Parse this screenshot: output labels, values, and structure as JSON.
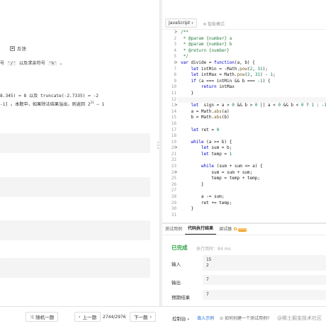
{
  "left": {
    "meta": {
      "flag_label": "反馈"
    },
    "desc_line1": {
      "a": "号 ",
      "code1": "'/'",
      "b": " 以及求余符号 ",
      "code2": "'%'",
      "c": " 。"
    },
    "desc_line2": {
      "a": "8.345) = 8 以及 truncate(-2.7335) = -2"
    },
    "desc_line3": {
      "a": "-1] 。本题中，如果除法结果溢出，则返回 2",
      "sup": "31",
      "b": " − 1"
    }
  },
  "editor": {
    "language": "JavaScript",
    "smart_mode": "智能模式",
    "line_numbers": [
      "1",
      "2",
      "3",
      "4",
      "5",
      "6",
      "7",
      "8",
      "9",
      "10",
      "11",
      "12",
      "13",
      "14",
      "15",
      "16",
      "17",
      "18",
      "19",
      "20",
      "21",
      "22",
      "23",
      "24",
      "25",
      "26",
      "27",
      "28",
      "29",
      "30",
      "31"
    ]
  },
  "console": {
    "tabs": [
      "测试用例",
      "代码执行结果",
      "调试器"
    ],
    "debugger_badge": "Beta",
    "status": "已完成",
    "runtime": "执行用时：84 ms",
    "input_label": "输入",
    "input_value_1": "15",
    "input_value_2": "2",
    "output_label": "输出",
    "output_value": "7",
    "expected_label": "预期结果",
    "expected_value": "7"
  },
  "bottom": {
    "random_label": "随机一题",
    "prev_label": "上一题",
    "pager": "2744/2976",
    "next_label": "下一题",
    "console_label": "控制台",
    "example_link": "填入示例",
    "help_text": "如何创建一个测试用例?",
    "watermark": "@稀土掘金技术社区"
  }
}
